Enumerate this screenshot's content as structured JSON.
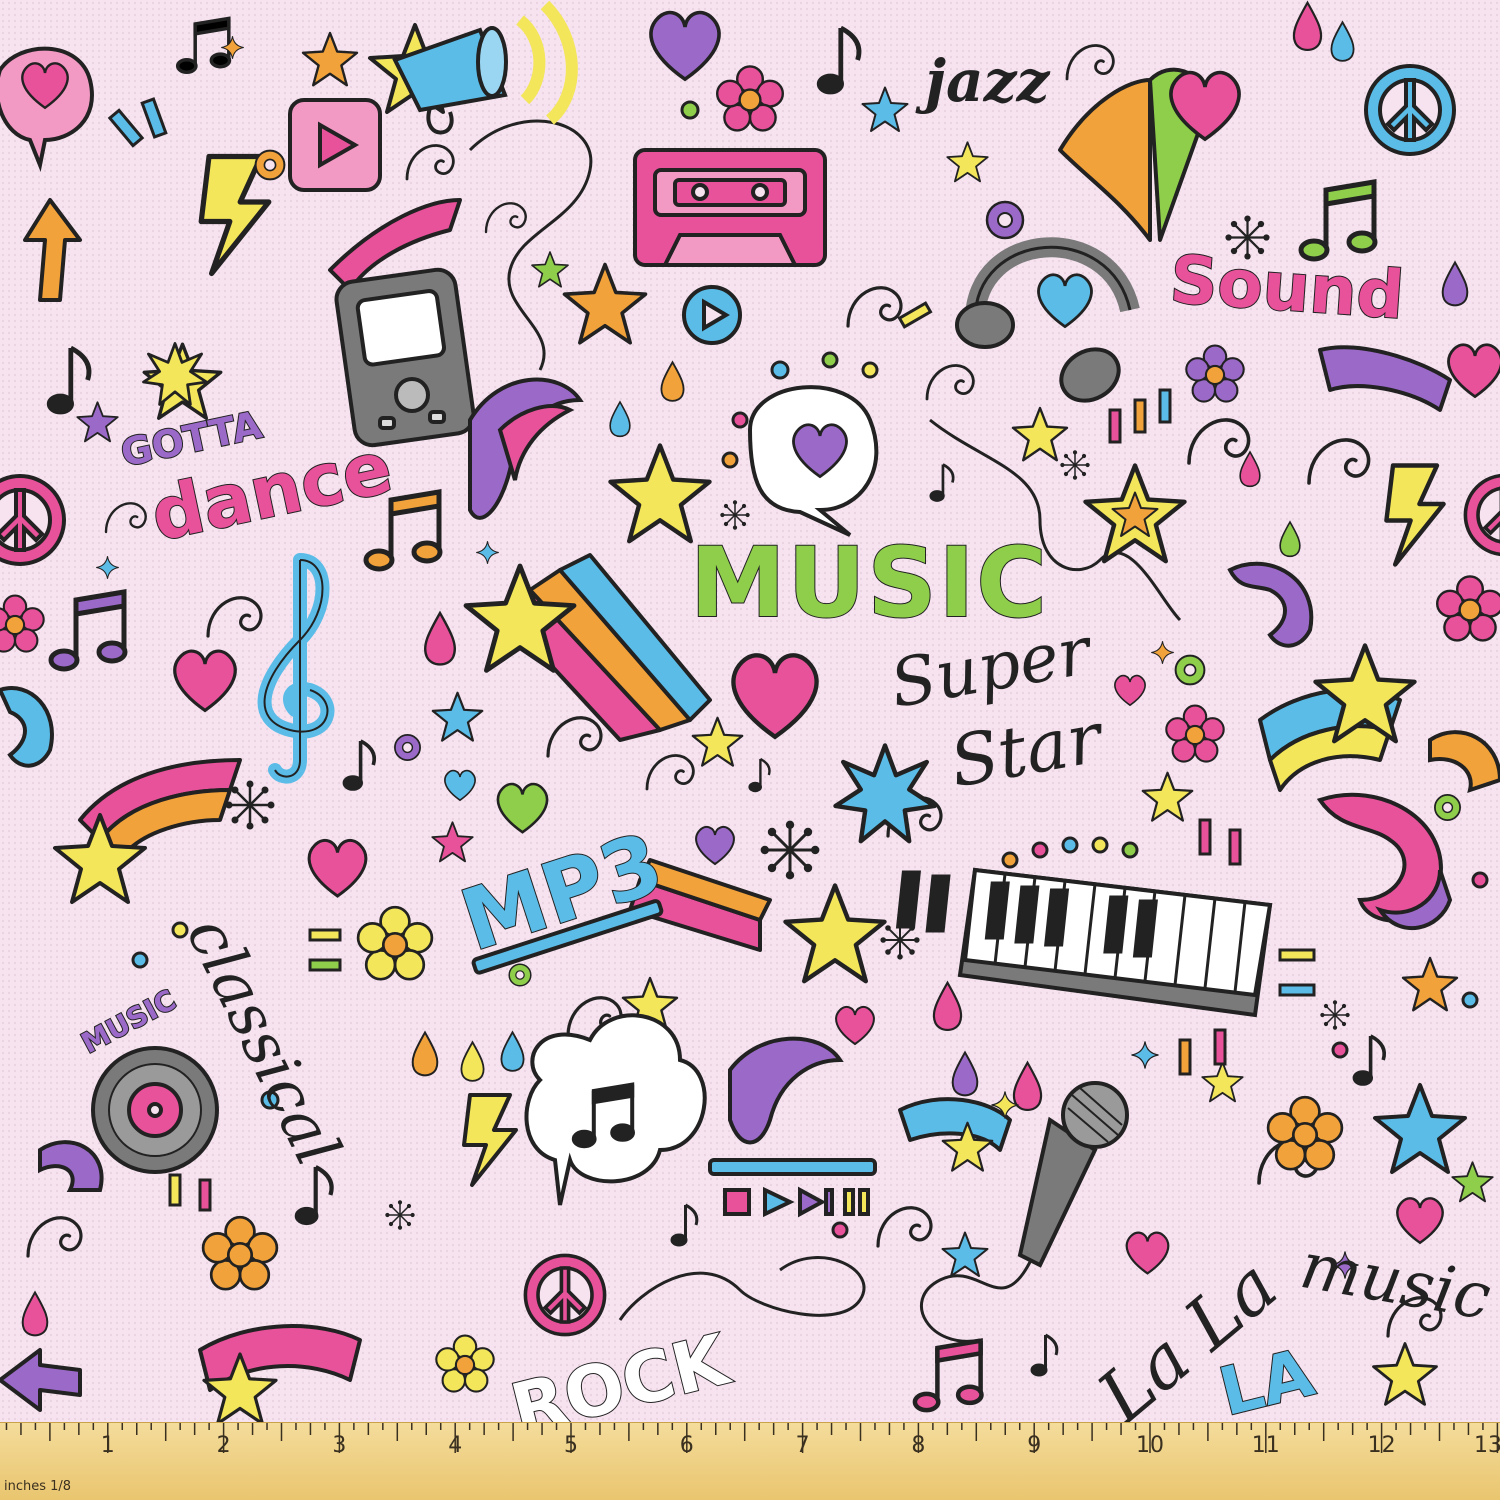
{
  "doodle_words": {
    "jazz": "jazz",
    "sound": "Sound",
    "gotta": "GOTTA",
    "dance": "dance",
    "music": "MUSIC",
    "super": "Super",
    "star": "Star",
    "mp3": "MP3",
    "classical": "classical",
    "small_music": "MUSIC",
    "rock": "ROCK",
    "la_la": "La La",
    "music_script": "music",
    "la": "LA"
  },
  "ruler": {
    "unit_label": "inches 1/8",
    "numbers": [
      "1",
      "2",
      "3",
      "4",
      "5",
      "6",
      "7",
      "8",
      "9",
      "10",
      "11",
      "12",
      "13"
    ]
  },
  "colors": {
    "background": "#f6e3ef",
    "pink": "#e8529a",
    "purple": "#9b6ac8",
    "blue": "#5bbce8",
    "yellow": "#f3e65a",
    "orange": "#f2a23a",
    "green": "#8fce4b",
    "ink": "#222222",
    "ruler": "#f0d48a"
  }
}
